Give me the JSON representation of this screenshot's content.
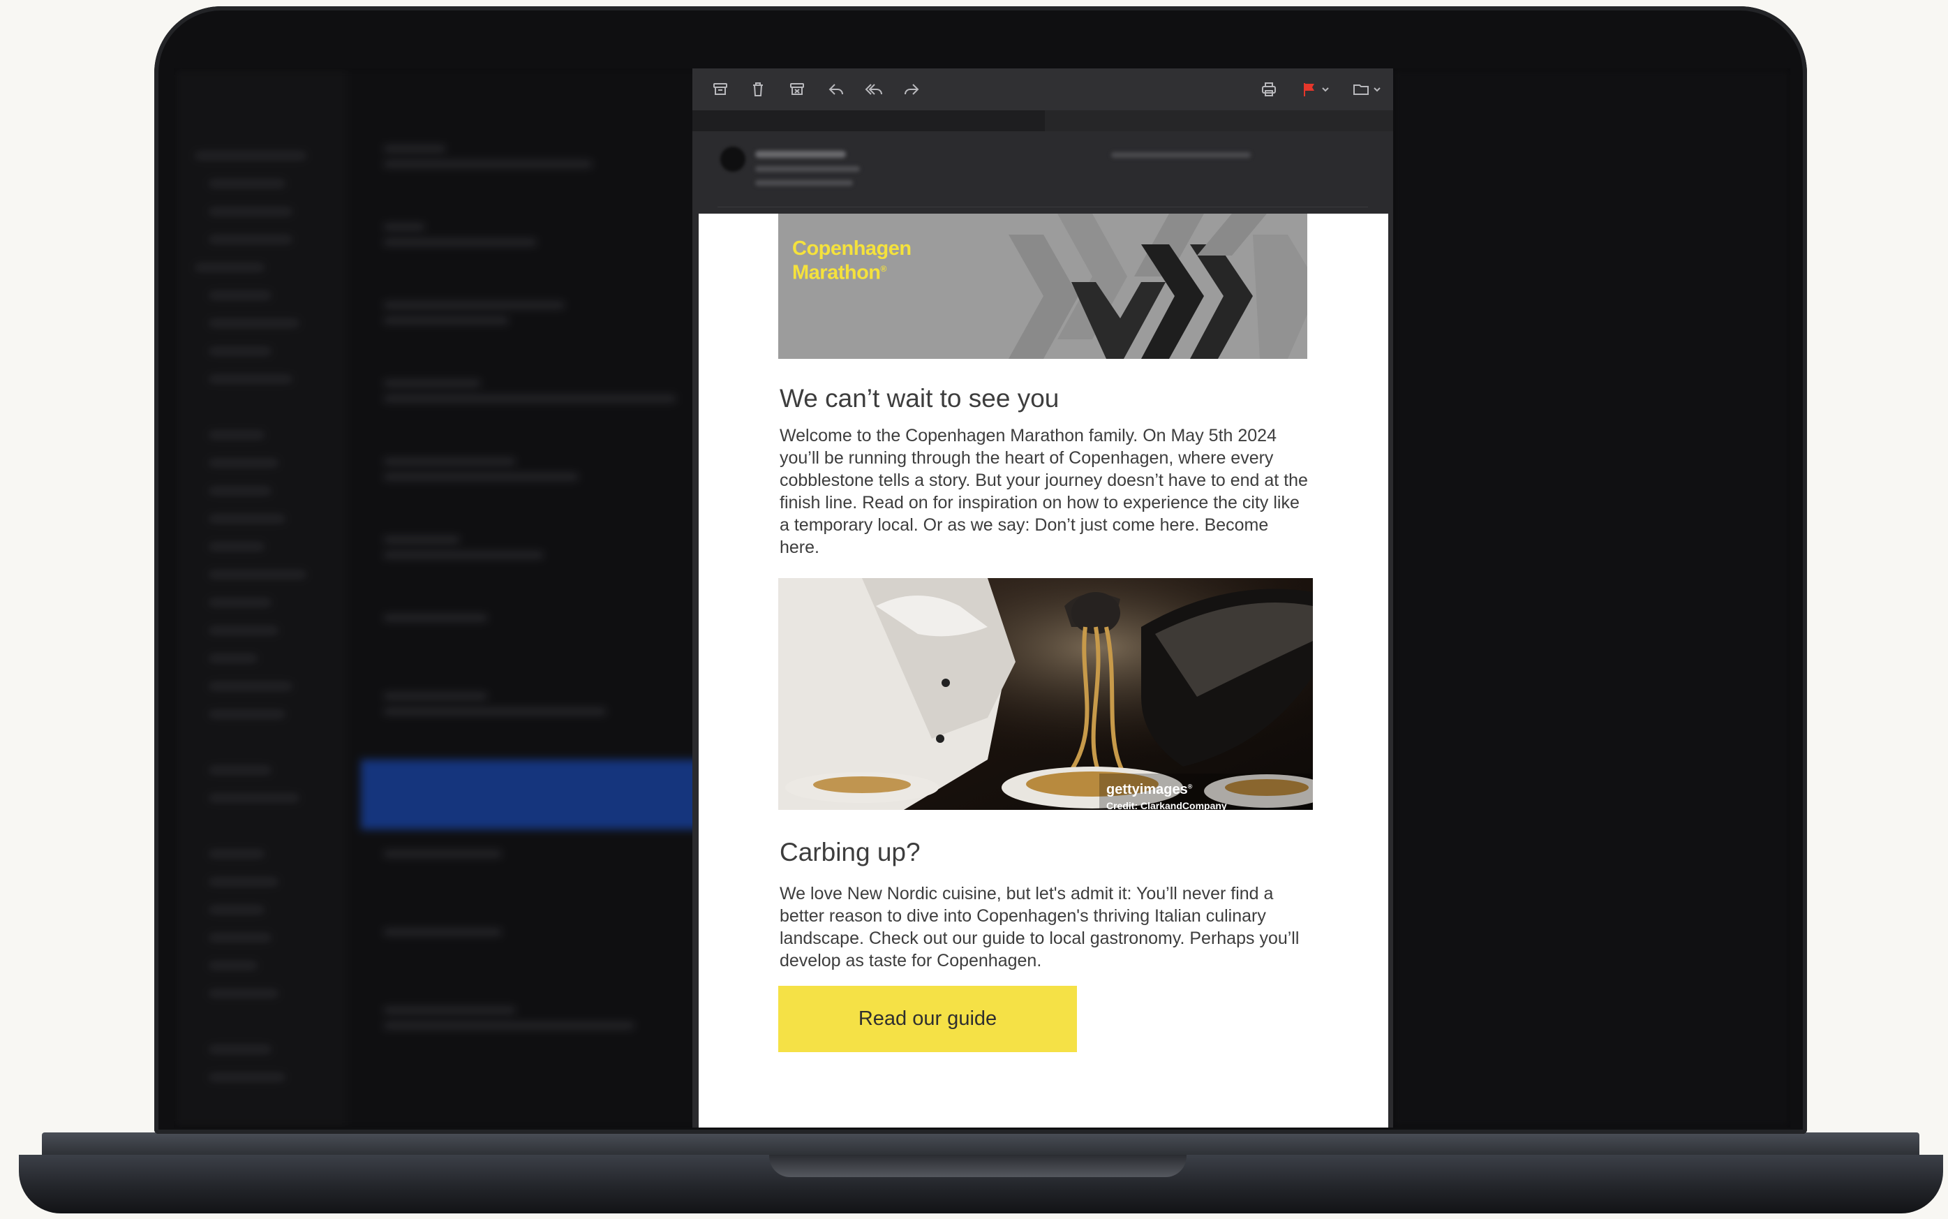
{
  "colors": {
    "brand_yellow": "#f5e146",
    "flag_red": "#e5372b",
    "banner_gray": "#9c9c9c",
    "text": "#3d3d3d"
  },
  "toolbar": {
    "left_icons": [
      "archive-icon",
      "trash-icon",
      "junk-icon",
      "reply-icon",
      "reply-all-icon",
      "forward-icon"
    ],
    "right_icons": [
      "print-icon",
      "flag-icon",
      "chevron-down-icon",
      "folder-icon",
      "chevron-down-icon"
    ]
  },
  "email": {
    "banner_brand_line1": "Copenhagen",
    "banner_brand_line2": "Marathon",
    "banner_brand_mark": "®",
    "heading": "We can’t wait to see you",
    "intro": "Welcome to the Copenhagen Marathon family. On May 5th 2024 you’ll be running through the heart of Copenhagen, where every cobblestone tells a story. But your journey doesn’t have to end at the finish line. Read on for inspiration on how to experience the city like a temporary local. Or as we say: Don’t just come here. Become here.",
    "photo_watermark": "gettyimages",
    "photo_watermark_mark": "®",
    "photo_credit": "Credit: ClarkandCompany",
    "section_heading": "Carbing up?",
    "section_text": "We love New Nordic cuisine, but let's admit it: You’ll never find a better reason to dive into Copenhagen's thriving Italian culinary landscape. Check out our guide to local gastronomy. Perhaps you’ll develop as taste for Copenhagen.",
    "cta_label": "Read our guide"
  }
}
